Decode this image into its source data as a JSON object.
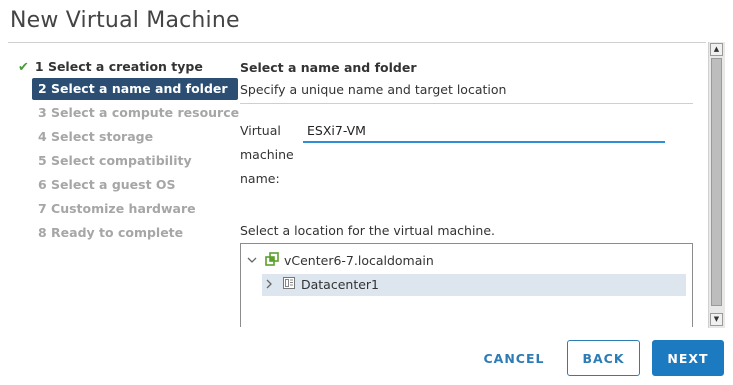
{
  "dialog": {
    "title": "New Virtual Machine"
  },
  "steps": [
    {
      "label": "1 Select a creation type",
      "state": "done"
    },
    {
      "label": "2 Select a name and folder",
      "state": "active"
    },
    {
      "label": "3 Select a compute resource",
      "state": "disabled"
    },
    {
      "label": "4 Select storage",
      "state": "disabled"
    },
    {
      "label": "5 Select compatibility",
      "state": "disabled"
    },
    {
      "label": "6 Select a guest OS",
      "state": "disabled"
    },
    {
      "label": "7 Customize hardware",
      "state": "disabled"
    },
    {
      "label": "8 Ready to complete",
      "state": "disabled"
    }
  ],
  "main": {
    "heading": "Select a name and folder",
    "subheading": "Specify a unique name and target location",
    "name_label": "Virtual machine name:",
    "name_value": "ESXi7-VM",
    "location_label": "Select a location for the virtual machine.",
    "tree": [
      {
        "label": "vCenter6-7.localdomain",
        "icon": "vcenter-icon",
        "expanded": true
      },
      {
        "label": "Datacenter1",
        "icon": "datacenter-icon",
        "expanded": false,
        "selected": true
      }
    ]
  },
  "footer": {
    "cancel_label": "CANCEL",
    "back_label": "BACK",
    "next_label": "NEXT"
  },
  "colors": {
    "active_step_bg": "#2c4e73",
    "check_green": "#4b9b3c",
    "input_underline": "#2d8fd5",
    "primary_button": "#1b7ac0",
    "selected_row": "#dde6ee"
  }
}
